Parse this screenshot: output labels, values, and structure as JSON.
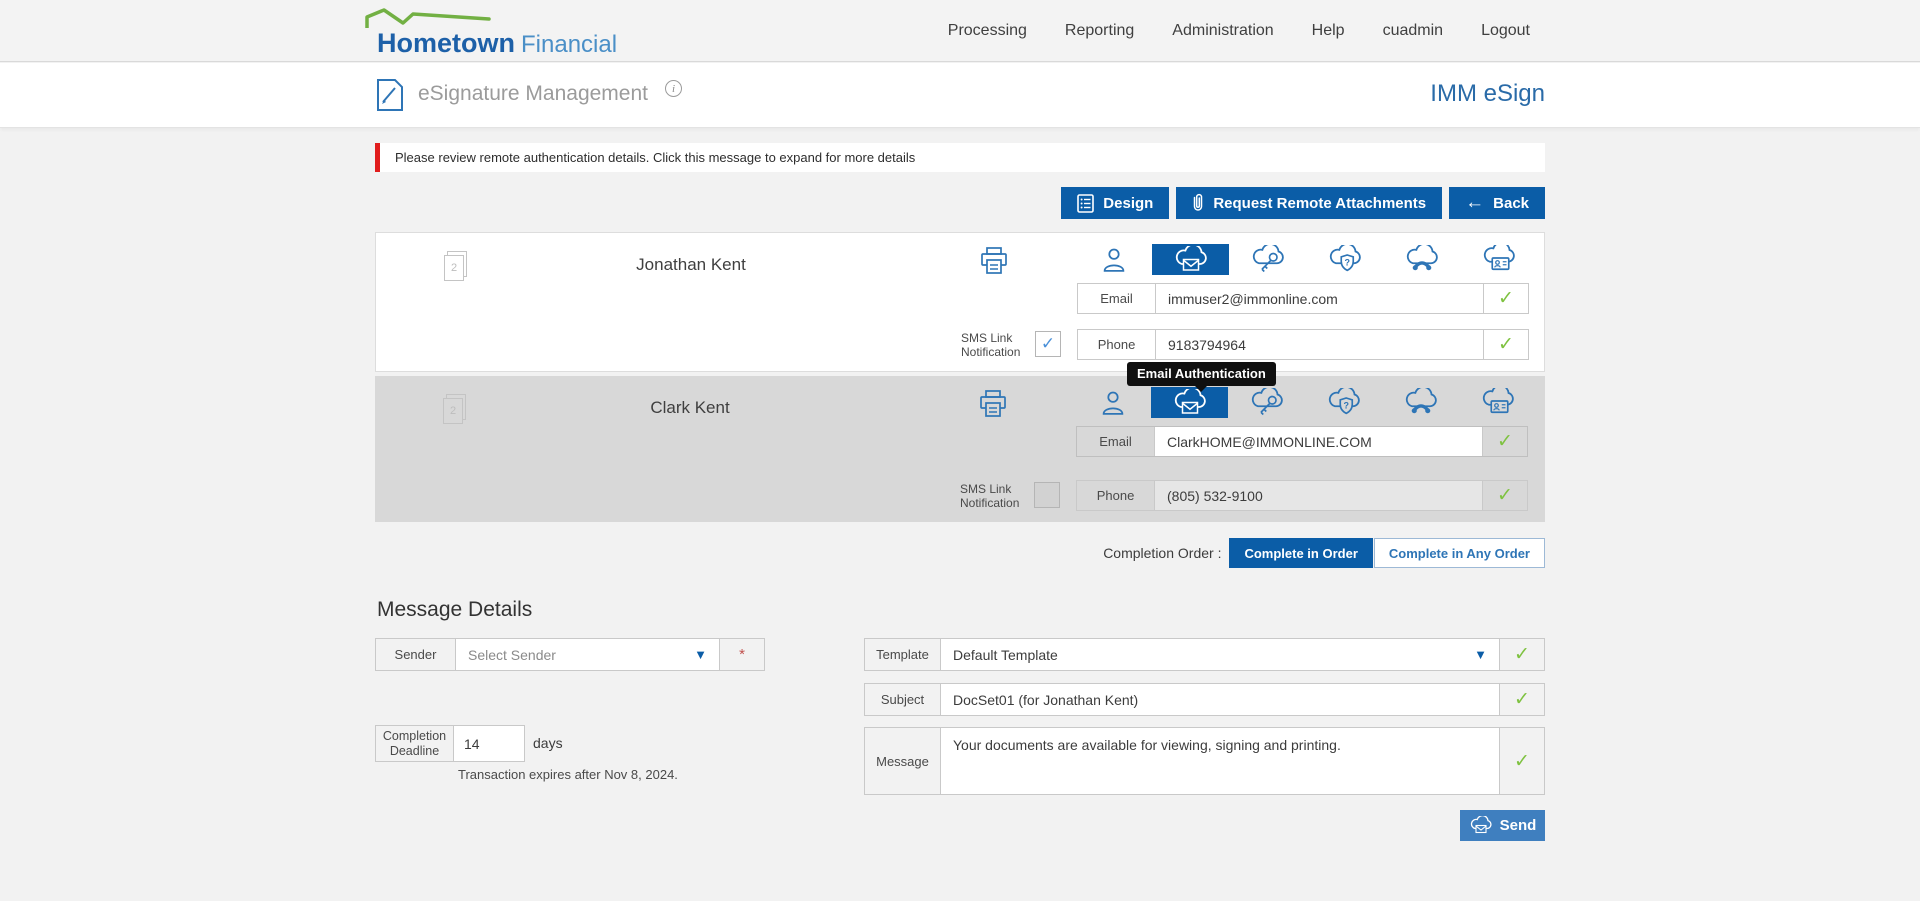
{
  "brand": {
    "name_primary": "Hometown",
    "name_secondary": "Financial"
  },
  "nav": {
    "items": [
      "Processing",
      "Reporting",
      "Administration",
      "Help",
      "cuadmin",
      "Logout"
    ]
  },
  "header": {
    "page_title": "eSignature Management",
    "product": "IMM eSign"
  },
  "alert": {
    "text": "Please review remote authentication details. Click this message to expand for more details"
  },
  "toolbar": {
    "design_label": "Design",
    "attachments_label": "Request Remote Attachments",
    "back_label": "Back"
  },
  "recipients": [
    {
      "name": "Jonathan Kent",
      "pages": "2",
      "email_label": "Email",
      "email": "immuser2@immonline.com",
      "sms_label": "SMS Link Notification",
      "phone_label": "Phone",
      "phone": "9183794964"
    },
    {
      "name": "Clark Kent",
      "pages": "2",
      "email_label": "Email",
      "email": "ClarkHOME@IMMONLINE.COM",
      "sms_label": "SMS Link Notification",
      "phone_label": "Phone",
      "phone": "(805) 532-9100"
    }
  ],
  "tooltip": {
    "text": "Email Authentication"
  },
  "completion_order": {
    "label": "Completion Order :",
    "in_order": "Complete in Order",
    "any_order": "Complete in Any Order"
  },
  "message_details": {
    "heading": "Message Details",
    "sender_label": "Sender",
    "sender_placeholder": "Select Sender",
    "required_marker": "*",
    "deadline_label": "Completion Deadline",
    "deadline_value": "14",
    "deadline_unit": "days",
    "expiry_note": "Transaction expires after Nov 8, 2024.",
    "template_label": "Template",
    "template_value": "Default Template",
    "subject_label": "Subject",
    "subject_value": "DocSet01 (for Jonathan Kent)",
    "message_label": "Message",
    "message_value": "Your documents are available for viewing, signing and printing.",
    "send_label": "Send"
  },
  "glyphs": {
    "check": "✓",
    "dropdown": "▼",
    "back_arrow": "←"
  },
  "colors": {
    "primary_blue": "#0b5da7",
    "icon_blue": "#2e75b6",
    "send_blue": "#3f7fbf",
    "green_check": "#7fc241",
    "alert_red": "#e11d1d",
    "row_gray": "#d8d8d8",
    "logo_green": "#72b043"
  }
}
